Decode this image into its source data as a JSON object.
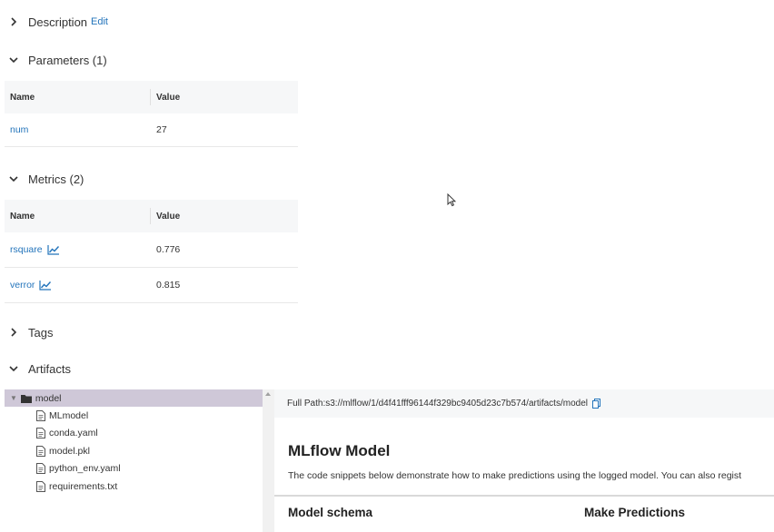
{
  "description": {
    "label": "Description",
    "edit": "Edit"
  },
  "parameters": {
    "label": "Parameters (1)",
    "columns": [
      "Name",
      "Value"
    ],
    "rows": [
      {
        "name": "num",
        "value": "27"
      }
    ]
  },
  "metrics": {
    "label": "Metrics (2)",
    "columns": [
      "Name",
      "Value"
    ],
    "rows": [
      {
        "name": "rsquare",
        "value": "0.776"
      },
      {
        "name": "verror",
        "value": "0.815"
      }
    ]
  },
  "tags": {
    "label": "Tags"
  },
  "artifacts": {
    "label": "Artifacts",
    "tree": {
      "root": "model",
      "files": [
        "MLmodel",
        "conda.yaml",
        "model.pkl",
        "python_env.yaml",
        "requirements.txt"
      ]
    },
    "viewer": {
      "path_label": "Full Path:",
      "path": "s3://mlflow/1/d4f41fff96144f329bc9405d23c7b574/artifacts/model",
      "title": "MLflow Model",
      "description": "The code snippets below demonstrate how to make predictions using the logged model. You can also regist",
      "schema_heading": "Model schema",
      "predict_heading": "Make Predictions"
    }
  },
  "colors": {
    "link": "#2374bb",
    "tree_selected": "#cfc8d8",
    "header_bg": "#f6f7f8"
  }
}
